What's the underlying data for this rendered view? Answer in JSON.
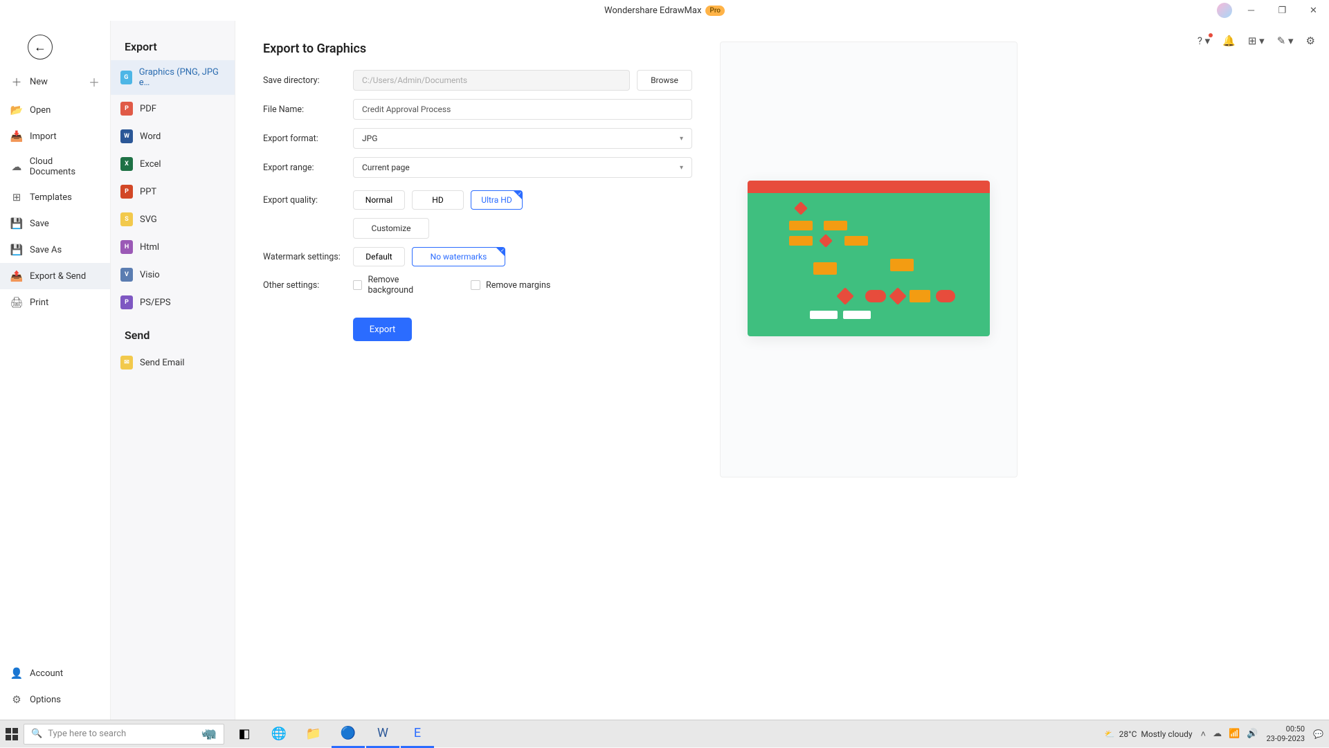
{
  "titlebar": {
    "app": "Wondershare EdrawMax",
    "badge": "Pro"
  },
  "sidebar1": {
    "items": [
      {
        "icon": "＋",
        "label": "New",
        "plus": true
      },
      {
        "icon": "📂",
        "label": "Open"
      },
      {
        "icon": "📥",
        "label": "Import"
      },
      {
        "icon": "☁",
        "label": "Cloud Documents"
      },
      {
        "icon": "⊞",
        "label": "Templates"
      },
      {
        "icon": "💾",
        "label": "Save"
      },
      {
        "icon": "💾",
        "label": "Save As"
      },
      {
        "icon": "📤",
        "label": "Export & Send"
      },
      {
        "icon": "🖨",
        "label": "Print"
      }
    ],
    "bottom": [
      {
        "icon": "👤",
        "label": "Account"
      },
      {
        "icon": "⚙",
        "label": "Options"
      }
    ]
  },
  "sidebar2": {
    "export_title": "Export",
    "send_title": "Send",
    "formats": [
      {
        "ico": "G",
        "color": "#4db6e6",
        "label": "Graphics (PNG, JPG e…"
      },
      {
        "ico": "P",
        "color": "#e05a47",
        "label": "PDF"
      },
      {
        "ico": "W",
        "color": "#2b5797",
        "label": "Word"
      },
      {
        "ico": "X",
        "color": "#1e7145",
        "label": "Excel"
      },
      {
        "ico": "P",
        "color": "#d24726",
        "label": "PPT"
      },
      {
        "ico": "S",
        "color": "#f2c94c",
        "label": "SVG"
      },
      {
        "ico": "H",
        "color": "#9b59b6",
        "label": "Html"
      },
      {
        "ico": "V",
        "color": "#5b7db1",
        "label": "Visio"
      },
      {
        "ico": "P",
        "color": "#7e57c2",
        "label": "PS/EPS"
      }
    ],
    "send": [
      {
        "ico": "✉",
        "color": "#f2c94c",
        "label": "Send Email"
      }
    ]
  },
  "form": {
    "heading": "Export to Graphics",
    "save_dir_label": "Save directory:",
    "save_dir_value": "C:/Users/Admin/Documents",
    "browse": "Browse",
    "filename_label": "File Name:",
    "filename_value": "Credit Approval Process",
    "format_label": "Export format:",
    "format_value": "JPG",
    "range_label": "Export range:",
    "range_value": "Current page",
    "quality_label": "Export quality:",
    "quality_options": [
      "Normal",
      "HD",
      "Ultra HD"
    ],
    "customize": "Customize",
    "watermark_label": "Watermark settings:",
    "watermark_options": [
      "Default",
      "No watermarks"
    ],
    "other_label": "Other settings:",
    "remove_bg": "Remove background",
    "remove_margins": "Remove margins",
    "export_btn": "Export"
  },
  "taskbar": {
    "search_placeholder": "Type here to search",
    "weather_temp": "28°C",
    "weather_text": "Mostly cloudy",
    "time": "00:50",
    "date": "23-09-2023"
  }
}
